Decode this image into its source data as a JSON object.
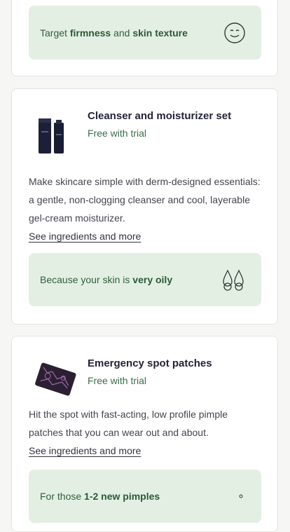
{
  "top_banner": {
    "prefix": "Target ",
    "bold1": "firmness",
    "middle": " and ",
    "bold2": "skin texture",
    "icon": "smile-face-icon"
  },
  "products": [
    {
      "title": "Cleanser and moisturizer set",
      "subtitle": "Free with trial",
      "description": "Make skincare simple with derm-designed essentials: a gentle, non-clogging cleanser and cool, layerable gel-cream moisturizer.",
      "link": "See ingredients and more",
      "banner": {
        "prefix": "Because your skin is ",
        "bold": "very oily",
        "icon": "oil-drops-icon"
      }
    },
    {
      "title": "Emergency spot patches",
      "subtitle": "Free with trial",
      "description": "Hit the spot with fast-acting, low profile pimple patches that you can wear out and about.",
      "link": "See ingredients and more",
      "banner": {
        "prefix": "For those ",
        "bold": "1-2 new pimples",
        "icon": "dot-icon"
      }
    }
  ]
}
